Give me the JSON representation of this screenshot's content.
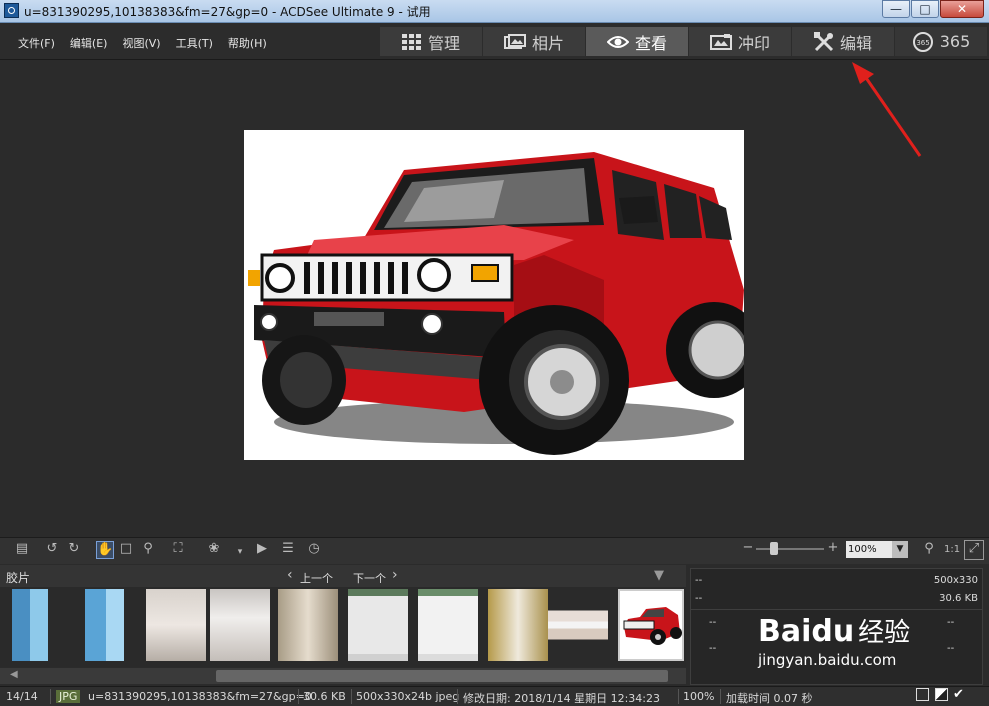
{
  "window": {
    "title": "u=831390295,10138383&fm=27&gp=0 - ACDSee Ultimate 9 - 试用"
  },
  "menu": [
    "文件(F)",
    "编辑(E)",
    "视图(V)",
    "工具(T)",
    "帮助(H)"
  ],
  "modes": [
    {
      "label": "管理",
      "icon": "grid-icon"
    },
    {
      "label": "相片",
      "icon": "photos-icon"
    },
    {
      "label": "查看",
      "icon": "eye-icon",
      "active": true
    },
    {
      "label": "冲印",
      "icon": "develop-icon"
    },
    {
      "label": "编辑",
      "icon": "edit-tools-icon"
    },
    {
      "label": "365",
      "icon": "365-icon"
    }
  ],
  "viewer": {
    "image_caption": "red Hummer H2 SUV illustration"
  },
  "toolbar": {
    "zoom": "100%",
    "ratio_label": "1:1"
  },
  "filmstrip": {
    "title": "胶片",
    "prev_label": "上一个",
    "next_label": "下一个",
    "thumb_count": 10,
    "selected_index": 9
  },
  "info": {
    "line1_left": "--",
    "dims": "500x330",
    "line2_left": "--",
    "size": "30.6 KB",
    "cell": "--"
  },
  "status": {
    "position": "14/14",
    "format": "JPG",
    "filename": "u=831390295,10138383&fm=27&gp=0",
    "filesize": "30.6 KB",
    "dims": "500x330x24b jpeg",
    "modified": "修改日期: 2018/1/14 星期日 12:34:23",
    "zoom": "100%",
    "load": "加载时间 0.07 秒"
  },
  "watermark": {
    "brand": "Baidu",
    "chinese": "经验",
    "url": "jingyan.baidu.com"
  },
  "colors": {
    "accent_red": "#e0201c",
    "car_red": "#c8141a",
    "active_mode": "#5a5a5a"
  }
}
